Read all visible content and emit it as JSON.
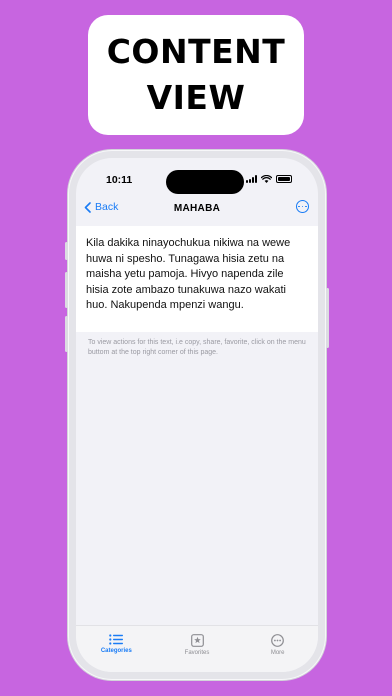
{
  "promo": {
    "line1": "CONTENT",
    "line2": "VIEW"
  },
  "status_bar": {
    "time": "10:11"
  },
  "nav": {
    "back_label": "Back",
    "title": "MAHABA",
    "menu_icon": "ellipsis-circle-icon"
  },
  "content": {
    "text": "Kila dakika ninayochukua nikiwa na wewe huwa ni spesho. Tunagawa hisia zetu na maisha yetu pamoja. Hivyo napenda zile hisia zote ambazo tunakuwa nazo wakati huo. Nakupenda mpenzi wangu."
  },
  "hint": "To view actions for this text, i.e copy, share, favorite, click on the menu buttom at the top right corner of this page.",
  "tabs": [
    {
      "label": "Categories",
      "icon": "list-icon",
      "active": true
    },
    {
      "label": "Favorites",
      "icon": "star-square-icon",
      "active": false
    },
    {
      "label": "More",
      "icon": "ellipsis-circle-icon",
      "active": false
    }
  ],
  "colors": {
    "background": "#c765e0",
    "accent": "#1a7cf5"
  }
}
